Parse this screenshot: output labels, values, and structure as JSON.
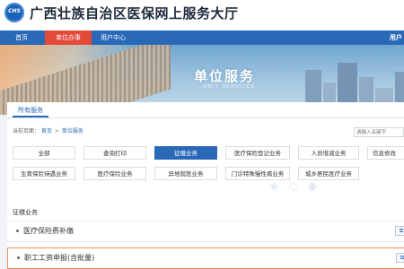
{
  "site": {
    "logo_text": "CHS",
    "title": "广西壮族自治区医保网上服务大厅"
  },
  "nav": {
    "items": [
      {
        "label": "首页"
      },
      {
        "label": "单位办事"
      },
      {
        "label": "用户中心"
      }
    ],
    "user_label": "用户"
  },
  "banner": {
    "title": "单位服务",
    "subtitle": "UNIT SERVICES"
  },
  "tab": {
    "label": "所有服务"
  },
  "breadcrumb": {
    "prefix": "当前页面：",
    "home": "首页",
    "separator": ">",
    "current": "单位服务"
  },
  "search": {
    "placeholder": "请输入关键字"
  },
  "categories": [
    {
      "label": "全部"
    },
    {
      "label": "查询打印"
    },
    {
      "label": "征缴业务"
    },
    {
      "label": "医疗保险登记业务"
    },
    {
      "label": "人员增减业务"
    },
    {
      "label": "信息修改"
    },
    {
      "label": "生育保险待遇业务"
    },
    {
      "label": "医疗保险业务"
    },
    {
      "label": "异地就医业务"
    },
    {
      "label": "门诊特殊慢性病业务"
    },
    {
      "label": "城乡居民医疗业务"
    }
  ],
  "active_category": "征缴业务",
  "section": {
    "title": "征缴业务"
  },
  "services": [
    {
      "label": "医疗保险费补缴"
    },
    {
      "label": "职工工资申报(含批量)"
    }
  ],
  "colors": {
    "nav_blue": "#2a69b7",
    "active_red": "#e34a3a",
    "highlight_orange": "#f08a5d"
  }
}
